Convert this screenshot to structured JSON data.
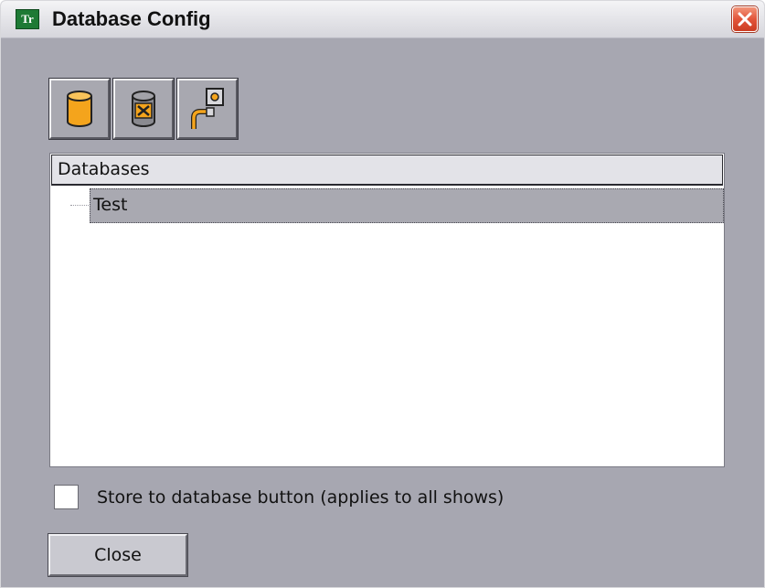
{
  "window": {
    "title": "Database Config",
    "app_icon_text": "Tr",
    "close_icon": "close-icon"
  },
  "toolbar": {
    "buttons": [
      {
        "name": "add-database",
        "icon": "database-icon"
      },
      {
        "name": "delete-database",
        "icon": "database-delete-icon"
      },
      {
        "name": "connect-database",
        "icon": "plug-connect-icon"
      }
    ]
  },
  "tree": {
    "header": "Databases",
    "items": [
      {
        "label": "Test",
        "selected": true
      }
    ]
  },
  "options": {
    "store_button_label": "Store to database button (applies to all shows)",
    "store_button_checked": false
  },
  "footer": {
    "close_label": "Close"
  },
  "colors": {
    "window_bg": "#a7a7b1",
    "accent_orange": "#f4a41c",
    "close_red": "#e2553a",
    "selection": "#a9a9b1"
  }
}
